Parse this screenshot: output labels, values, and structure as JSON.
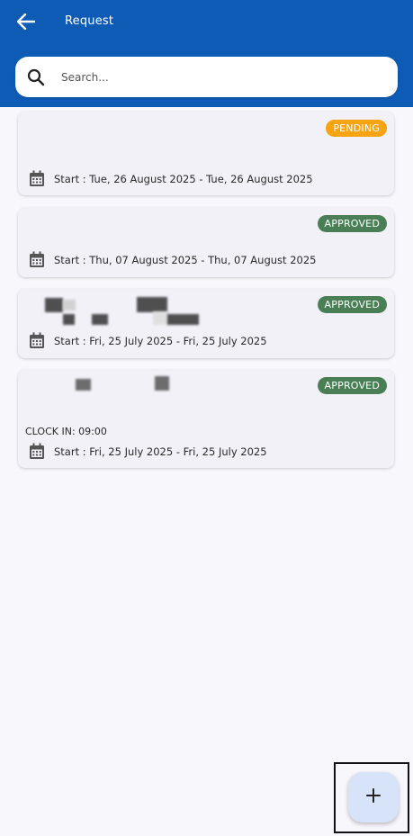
{
  "app_bar": {
    "title": "Request",
    "background": "#0d5bb5",
    "back_icon": "arrow-left-icon"
  },
  "search": {
    "placeholder": "Search...",
    "value": "",
    "icon": "search-icon"
  },
  "requests": [
    {
      "status": "PENDING",
      "status_color": "#f7a412",
      "date_range": "Start : Tue, 26 August 2025 - Tue, 26 August 2025",
      "icon": "calendar-icon"
    },
    {
      "status": "APPROVED",
      "status_color": "#4a7f56",
      "date_range": "Start : Thu, 07 August 2025 - Thu, 07 August 2025",
      "icon": "calendar-icon"
    },
    {
      "status": "APPROVED",
      "status_color": "#4a7f56",
      "date_range": "Start : Fri, 25 July 2025 - Fri, 25 July 2025",
      "icon": "calendar-icon"
    },
    {
      "status": "APPROVED",
      "status_color": "#4a7f56",
      "extra": "CLOCK IN: 09:00",
      "date_range": "Start : Fri, 25 July 2025 - Fri, 25 July 2025",
      "icon": "calendar-icon"
    }
  ],
  "fab": {
    "label": "+",
    "icon": "plus-icon",
    "background": "#d7e3f8"
  }
}
